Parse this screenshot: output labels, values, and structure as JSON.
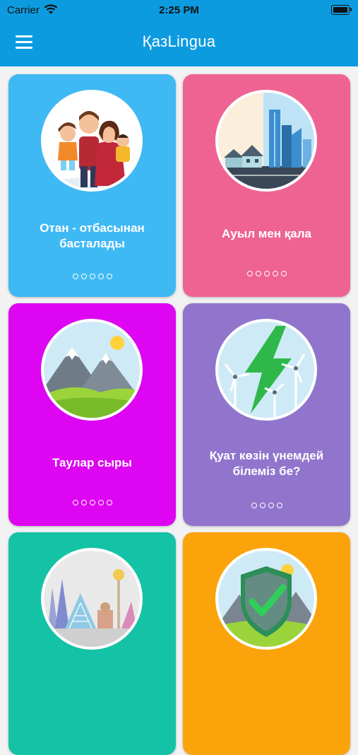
{
  "status": {
    "carrier": "Carrier",
    "time": "2:25 PM"
  },
  "app": {
    "title": "ҚазLingua",
    "menu_icon": "hamburger-menu-icon"
  },
  "colors": {
    "header": "#0d9be0",
    "background": "#f2f2f2"
  },
  "cards": [
    {
      "title": "Отан - отбасынан басталады",
      "color": "#3fb9f4",
      "icon": "family-illustration-icon",
      "progress_dots": 5
    },
    {
      "title": "Ауыл мен қала",
      "color": "#ef6393",
      "icon": "village-city-illustration-icon",
      "progress_dots": 5
    },
    {
      "title": "Таулар сыры",
      "color": "#dd05f2",
      "icon": "mountains-illustration-icon",
      "progress_dots": 5
    },
    {
      "title": "Қуат көзін үнемдей білеміз бе?",
      "color": "#9175cd",
      "icon": "wind-energy-illustration-icon",
      "progress_dots": 4
    },
    {
      "title": "",
      "color": "#14c2a6",
      "icon": "astana-city-illustration-icon",
      "progress_dots": 0
    },
    {
      "title": "",
      "color": "#fba30b",
      "icon": "shield-check-illustration-icon",
      "progress_dots": 0
    }
  ]
}
